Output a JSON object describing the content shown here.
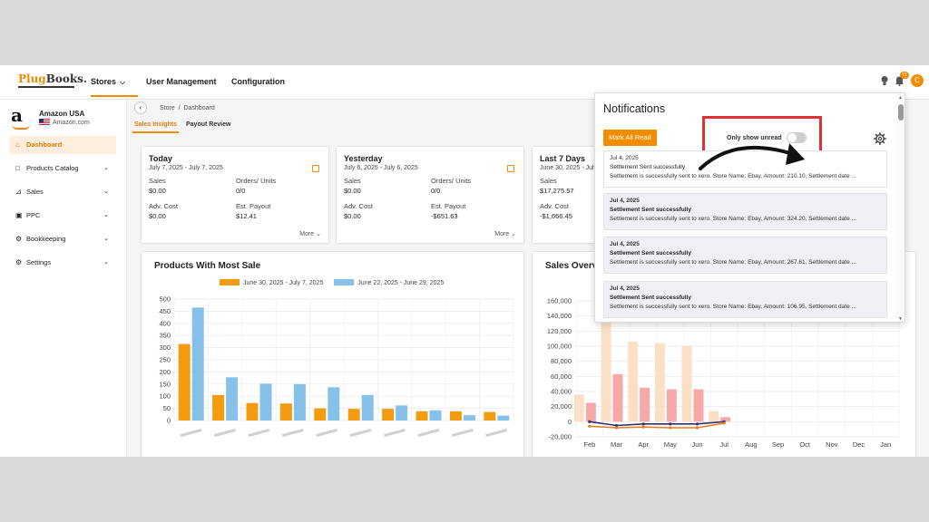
{
  "colors": {
    "accent": "#f28c00",
    "series_orange": "#f39c12",
    "series_blue": "#85c1e9",
    "highlight": "#e03030"
  },
  "topnav": {
    "logo_text_a": "Plug",
    "logo_text_b": "Books.",
    "items": [
      {
        "label": "Stores"
      },
      {
        "label": "User Management"
      },
      {
        "label": "Configuration"
      }
    ],
    "bell_badge": "71",
    "avatar_initial": "C"
  },
  "sidebar": {
    "store_name": "Amazon USA",
    "store_domain": "Amazon.com",
    "items": [
      {
        "label": "Dashboard",
        "icon": "home-icon"
      },
      {
        "label": "Products Catalog",
        "icon": "box-icon"
      },
      {
        "label": "Sales",
        "icon": "chart-icon"
      },
      {
        "label": "PPC",
        "icon": "ppc-icon"
      },
      {
        "label": "Bookkeeping",
        "icon": "gear-icon"
      },
      {
        "label": "Settings",
        "icon": "gear-icon"
      }
    ]
  },
  "breadcrumb": {
    "store": "Store",
    "sep": "/",
    "page": "Dashboard"
  },
  "subtabs": [
    {
      "label": "Sales Insights"
    },
    {
      "label": "Payout Review"
    }
  ],
  "cards": [
    {
      "title": "Today",
      "range": "July 7, 2025 - July 7, 2025",
      "sales_label": "Sales",
      "sales": "$0.00",
      "orders_label": "Orders/ Units",
      "orders": "0/0",
      "adv_label": "Adv. Cost",
      "adv": "$0.00",
      "payout_label": "Est. Payout",
      "payout": "$12.41",
      "more": "More"
    },
    {
      "title": "Yesterday",
      "range": "July 6, 2025 - July 6, 2025",
      "sales_label": "Sales",
      "sales": "$0.00",
      "orders_label": "Orders/ Units",
      "orders": "0/0",
      "adv_label": "Adv. Cost",
      "adv": "$0.00",
      "payout_label": "Est. Payout",
      "payout": "-$651.63",
      "more": "More"
    },
    {
      "title": "Last 7 Days",
      "range": "June 30, 2025 - July",
      "sales_label": "Sales",
      "sales": "$17,275.57",
      "adv_label": "Adv. Cost",
      "adv": "-$1,666.45"
    }
  ],
  "notifications": {
    "title": "Notifications",
    "mark_all_label": "Mark All Read",
    "toggle_label": "Only show unread",
    "toggle_on": false,
    "items": [
      {
        "date": "Jul 4, 2025",
        "title": "Settlement Sent successfully",
        "body": "Settlement is successfully sent to xero. Store Name: Ebay, Amount: 210.10, Settlement date ...",
        "unread": false
      },
      {
        "date": "Jul 4, 2025",
        "title": "Settlement Sent successfully",
        "body": "Settlement is successfully sent to xero. Store Name: Ebay, Amount: 324.20, Settlement date ...",
        "unread": true
      },
      {
        "date": "Jul 4, 2025",
        "title": "Settlement Sent successfully",
        "body": "Settlement is successfully sent to xero. Store Name: Ebay, Amount: 267.61, Settlement date ...",
        "unread": true
      },
      {
        "date": "Jul 4, 2025",
        "title": "Settlement Sent successfully",
        "body": "Settlement is successfully sent to xero. Store Name: Ebay, Amount: 106.95, Settlement date ...",
        "unread": true
      }
    ]
  },
  "chart_data": [
    {
      "type": "bar",
      "title": "Products With Most Sale",
      "categories": [
        "",
        "",
        "",
        "",
        "",
        "",
        "",
        "",
        "",
        ""
      ],
      "series": [
        {
          "name": "June 30, 2025 - July 7, 2025",
          "values": [
            315,
            105,
            72,
            70,
            50,
            48,
            48,
            38,
            38,
            35
          ]
        },
        {
          "name": "June 22, 2025 - June 29, 2025",
          "values": [
            465,
            178,
            152,
            150,
            137,
            105,
            62,
            42,
            22,
            20
          ]
        }
      ],
      "yticks": [
        0,
        50,
        100,
        150,
        200,
        250,
        300,
        350,
        400,
        450,
        500
      ],
      "ylim": [
        0,
        500
      ]
    },
    {
      "type": "bar",
      "title": "Sales Overv",
      "categories": [
        "Feb",
        "Mar",
        "Apr",
        "May",
        "Jun",
        "Jul",
        "Aug",
        "Sep",
        "Oct",
        "Nov",
        "Dec",
        "Jan"
      ],
      "series": [
        {
          "values": [
            36000,
            160000,
            106000,
            104000,
            100000,
            14000,
            0,
            0,
            0,
            0,
            0,
            0
          ]
        },
        {
          "values": [
            25000,
            63000,
            45000,
            43000,
            43000,
            6000,
            0,
            0,
            0,
            0,
            0,
            0
          ]
        },
        {
          "type": "line",
          "values": [
            0,
            -5000,
            -3000,
            -3000,
            -3000,
            0
          ]
        },
        {
          "type": "line",
          "values": [
            -6000,
            -8000,
            -7000,
            -8000,
            -8000,
            -2000
          ]
        }
      ],
      "yticks": [
        "-20,000",
        "0",
        "20,000",
        "40,000",
        "60,000",
        "80,000",
        "100,000",
        "120,000",
        "140,000",
        "160,000"
      ],
      "ylim": [
        -20000,
        160000
      ]
    }
  ]
}
